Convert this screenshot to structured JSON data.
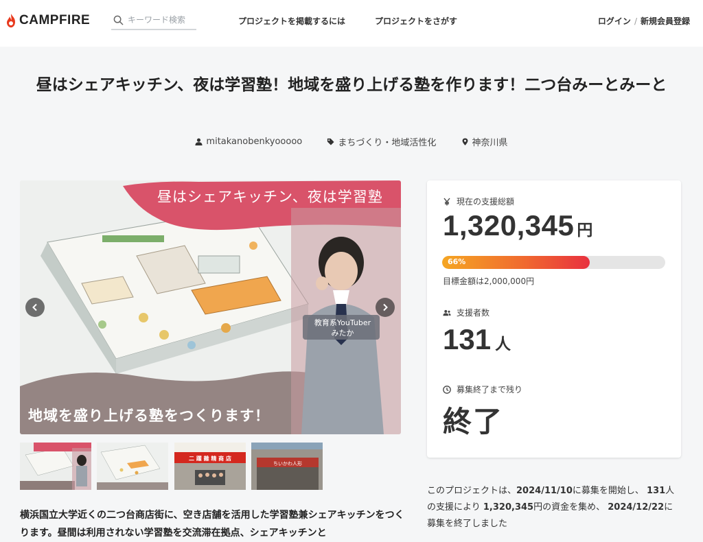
{
  "header": {
    "logo_text": "CAMPFIRE",
    "search_placeholder": "キーワード検索",
    "nav_post": "プロジェクトを掲載するには",
    "nav_find": "プロジェクトをさがす",
    "login": "ログイン",
    "separator": "/",
    "register": "新規会員登録"
  },
  "project": {
    "title": "昼はシェアキッチン、夜は学習塾！地域を盛り上げる塾を作ります！二つ台みーとみーと",
    "owner": "mitakanobenkyooooo",
    "category": "まちづくり・地域活性化",
    "location": "神奈川県"
  },
  "main_image": {
    "banner_top": "昼はシェアキッチン、夜は学習塾",
    "banner_bottom": "地域を盛り上げる塾をつくります！",
    "person_label_1": "教育系YouTuber",
    "person_label_2": "みたか"
  },
  "thumbnails": [
    {
      "shop_sign": ""
    },
    {
      "shop_sign": ""
    },
    {
      "shop_sign": "二 躍 雜 精 商 店"
    },
    {
      "shop_sign": "ちいかわ人形"
    }
  ],
  "description": "横浜国立大学近くの二つ台商店街に、空き店舗を活用した学習塾兼シェアキッチンをつくります。昼間は利用されない学習塾を交流滞在拠点、シェアキッチンと",
  "stats": {
    "amount_label": "現在の支援総額",
    "amount": "1,320,345",
    "amount_unit": "円",
    "progress_text": "66%",
    "progress_fraction": 0.66,
    "goal": "目標金額は2,000,000円",
    "backers_label": "支援者数",
    "backers": "131",
    "backers_unit": "人",
    "remaining_label": "募集終了まで残り",
    "remaining": "終了"
  },
  "summary": {
    "p1": "このプロジェクトは、",
    "start_date": "2024/11/10",
    "p2": "に募集を開始し、",
    "backers": "131",
    "p3": "人の支援により",
    "amount": "1,320,345",
    "p4": "円の資金を集め、",
    "end_date": "2024/12/22",
    "p5": "に募集を終了しました"
  },
  "colors": {
    "brand": "#e8391d",
    "progress_start": "#f5a623",
    "progress_end": "#e8313f",
    "banner_pink": "#d9536a"
  },
  "icons": {
    "logo": "campfire-flame-icon",
    "search": "search-icon",
    "owner": "user-icon",
    "category": "tag-icon",
    "location": "map-pin-icon",
    "amount": "yen-icon",
    "backers": "users-icon",
    "remaining": "clock-icon"
  }
}
